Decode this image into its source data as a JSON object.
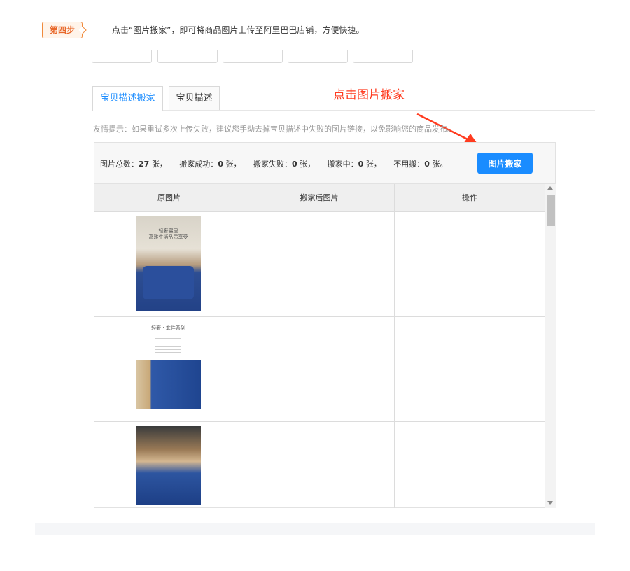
{
  "step": {
    "badge": "第四步",
    "text": "点击“图片搬家”，即可将商品图片上传至阿里巴巴店铺，方便快捷。"
  },
  "tabs": [
    {
      "label": "宝贝描述搬家",
      "active": true
    },
    {
      "label": "宝贝描述",
      "active": false
    }
  ],
  "annotation": "点击图片搬家",
  "tip": "友情提示：如果重试多次上传失败，建议您手动去掉宝贝描述中失败的图片链接，以免影响您的商品发布。",
  "stats": {
    "total_label": "图片总数：",
    "total": "27",
    "total_unit": "张，",
    "success_label": "搬家成功：",
    "success": "0",
    "success_unit": "张，",
    "failed_label": "搬家失败：",
    "failed": "0",
    "failed_unit": "张，",
    "moving_label": "搬家中：",
    "moving": "0",
    "moving_unit": "张，",
    "skip_label": "不用搬：",
    "skip": "0",
    "skip_unit": "张。"
  },
  "move_button": "图片搬家",
  "table": {
    "headers": [
      "原图片",
      "搬家后图片",
      "操作"
    ]
  },
  "thumbnails": {
    "img1_text": "轻奢寝居\n高雅生活品质享受",
    "img2_text": "轻奢 · 套件系列"
  },
  "colors": {
    "primary": "#1a8cff",
    "annotation": "#ff3b1f",
    "step_badge": "#e8682a"
  }
}
